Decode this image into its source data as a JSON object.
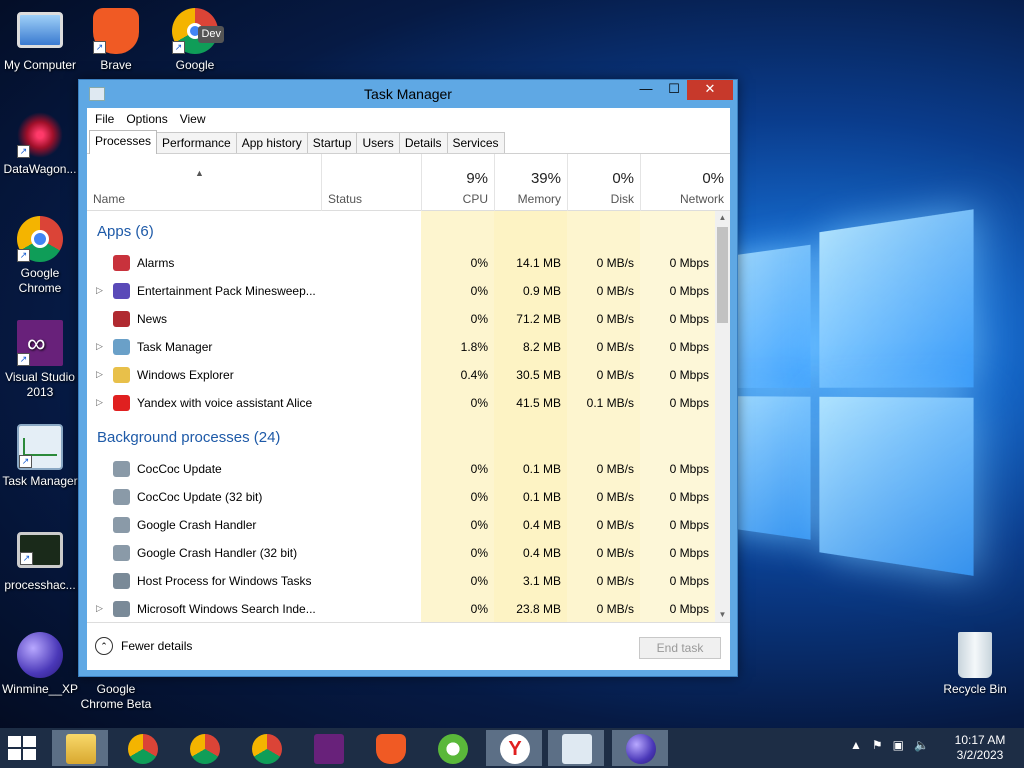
{
  "desktop": {
    "icons": [
      {
        "label": "My Computer"
      },
      {
        "label": "Brave"
      },
      {
        "label": "Google",
        "badge": "Dev"
      },
      {
        "label": "DataWagon..."
      },
      {
        "label": "Google Chrome"
      },
      {
        "label": "Visual Studio 2013"
      },
      {
        "label": "Task Manager"
      },
      {
        "label": "processhac..."
      },
      {
        "label": "Winmine__XP"
      },
      {
        "label": "Google Chrome Beta"
      },
      {
        "label": "Recycle Bin"
      }
    ]
  },
  "window": {
    "title": "Task Manager",
    "controls": {
      "minimize": "—",
      "maximize": "☐",
      "close": "✕"
    },
    "menu": [
      "File",
      "Options",
      "View"
    ],
    "tabs": [
      "Processes",
      "Performance",
      "App history",
      "Startup",
      "Users",
      "Details",
      "Services"
    ],
    "columns": {
      "name": "Name",
      "status": "Status",
      "cpu": {
        "pct": "9%",
        "label": "CPU"
      },
      "memory": {
        "pct": "39%",
        "label": "Memory"
      },
      "disk": {
        "pct": "0%",
        "label": "Disk"
      },
      "network": {
        "pct": "0%",
        "label": "Network"
      }
    },
    "groups": {
      "apps": "Apps (6)",
      "background": "Background processes (24)"
    },
    "apps": [
      {
        "name": "Alarms",
        "cpu": "0%",
        "memory": "14.1 MB",
        "disk": "0 MB/s",
        "network": "0 Mbps",
        "expandable": false,
        "icon": "alarm-icon",
        "color": "#c8323c"
      },
      {
        "name": "Entertainment Pack Minesweep...",
        "cpu": "0%",
        "memory": "0.9 MB",
        "disk": "0 MB/s",
        "network": "0 Mbps",
        "expandable": true,
        "icon": "minesweeper-icon",
        "color": "#5a4ab8"
      },
      {
        "name": "News",
        "cpu": "0%",
        "memory": "71.2 MB",
        "disk": "0 MB/s",
        "network": "0 Mbps",
        "expandable": false,
        "icon": "news-icon",
        "color": "#b02a30"
      },
      {
        "name": "Task Manager",
        "cpu": "1.8%",
        "memory": "8.2 MB",
        "disk": "0 MB/s",
        "network": "0 Mbps",
        "expandable": true,
        "icon": "task-manager-icon",
        "color": "#6aa0c8"
      },
      {
        "name": "Windows Explorer",
        "cpu": "0.4%",
        "memory": "30.5 MB",
        "disk": "0 MB/s",
        "network": "0 Mbps",
        "expandable": true,
        "icon": "folder-icon",
        "color": "#e8c04a"
      },
      {
        "name": "Yandex with voice assistant Alice",
        "cpu": "0%",
        "memory": "41.5 MB",
        "disk": "0.1 MB/s",
        "network": "0 Mbps",
        "expandable": true,
        "icon": "yandex-icon",
        "color": "#e02020"
      }
    ],
    "background": [
      {
        "name": "CocCoc Update",
        "cpu": "0%",
        "memory": "0.1 MB",
        "disk": "0 MB/s",
        "network": "0 Mbps",
        "expandable": false,
        "icon": "update-icon",
        "color": "#8a9aa8"
      },
      {
        "name": "CocCoc Update (32 bit)",
        "cpu": "0%",
        "memory": "0.1 MB",
        "disk": "0 MB/s",
        "network": "0 Mbps",
        "expandable": false,
        "icon": "update-icon",
        "color": "#8a9aa8"
      },
      {
        "name": "Google Crash Handler",
        "cpu": "0%",
        "memory": "0.4 MB",
        "disk": "0 MB/s",
        "network": "0 Mbps",
        "expandable": false,
        "icon": "crash-handler-icon",
        "color": "#8a9aa8"
      },
      {
        "name": "Google Crash Handler (32 bit)",
        "cpu": "0%",
        "memory": "0.4 MB",
        "disk": "0 MB/s",
        "network": "0 Mbps",
        "expandable": false,
        "icon": "crash-handler-icon",
        "color": "#8a9aa8"
      },
      {
        "name": "Host Process for Windows Tasks",
        "cpu": "0%",
        "memory": "3.1 MB",
        "disk": "0 MB/s",
        "network": "0 Mbps",
        "expandable": false,
        "icon": "host-process-icon",
        "color": "#7a8a98"
      },
      {
        "name": "Microsoft Windows Search Inde...",
        "cpu": "0%",
        "memory": "23.8 MB",
        "disk": "0 MB/s",
        "network": "0 Mbps",
        "expandable": true,
        "icon": "search-indexer-icon",
        "color": "#7a8a98"
      }
    ],
    "footer": {
      "fewer_details": "Fewer details",
      "end_task": "End task"
    }
  },
  "taskbar": {
    "time": "10:17 AM",
    "date": "3/2/2023"
  }
}
